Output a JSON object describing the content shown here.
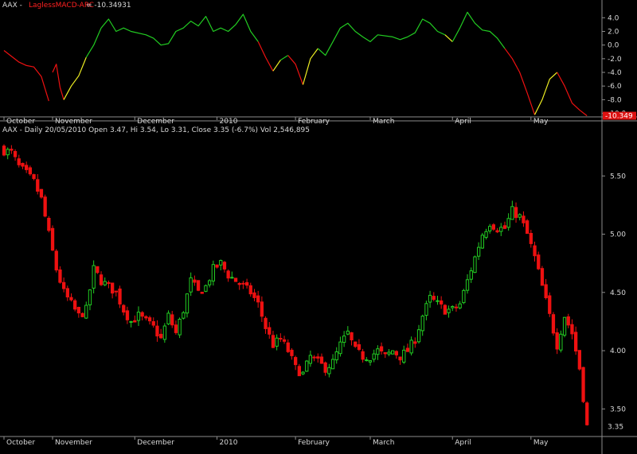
{
  "colors": {
    "background": "#000000",
    "text": "#d8d8d8",
    "axis_line": "#8c8c8c",
    "up": "#22cc22",
    "down": "#ee1111",
    "transition": "#eeee22",
    "indicator_name": "#ff2020"
  },
  "chart_data": [
    {
      "type": "line",
      "header": {
        "symbol": "AAX - ",
        "indicator": "LaglessMACD-ARC",
        "value_text": " = -10.34931"
      },
      "y_axis_ticks": [
        4.0,
        2.0,
        0.0,
        -2.0,
        -4.0,
        -6.0,
        -8.0,
        -10.0
      ],
      "y_tick_labels": [
        "4.0",
        "2.0",
        "0.0",
        "-2.0",
        "-4.0",
        "-6.0",
        "-8.0",
        "-10.0"
      ],
      "ylim": [
        -10.4,
        5.2
      ],
      "last_value_label": "-10.349",
      "x_index_range": [
        0,
        160
      ],
      "x_tick_labels": [
        "October",
        "November",
        "December",
        "2010",
        "February",
        "March",
        "April",
        "May"
      ],
      "x_tick_index": [
        0,
        13,
        35,
        57,
        78,
        98,
        120,
        141
      ],
      "series": [
        {
          "color_role": "down",
          "points": [
            [
              0,
              -0.8
            ],
            [
              4,
              -2.5
            ],
            [
              6,
              -3.0
            ],
            [
              8,
              -3.2
            ],
            [
              10,
              -4.6
            ],
            [
              12,
              -8.2
            ]
          ]
        },
        {
          "color_role": "down",
          "points": [
            [
              13,
              -4.0
            ],
            [
              14,
              -2.8
            ],
            [
              15,
              -6.2
            ],
            [
              16,
              -8.0
            ]
          ]
        },
        {
          "color_role": "transition",
          "points": [
            [
              16,
              -8.0
            ],
            [
              18,
              -6.0
            ],
            [
              20,
              -4.5
            ],
            [
              22,
              -1.8
            ]
          ]
        },
        {
          "color_role": "up",
          "points": [
            [
              22,
              -1.8
            ],
            [
              24,
              0.0
            ],
            [
              26,
              2.5
            ],
            [
              28,
              3.8
            ],
            [
              30,
              2.0
            ],
            [
              32,
              2.5
            ],
            [
              34,
              2.0
            ],
            [
              38,
              1.5
            ],
            [
              40,
              1.0
            ],
            [
              42,
              0.0
            ],
            [
              44,
              0.2
            ],
            [
              46,
              2.0
            ],
            [
              48,
              2.5
            ],
            [
              50,
              3.5
            ],
            [
              52,
              2.8
            ],
            [
              54,
              4.2
            ],
            [
              56,
              2.0
            ],
            [
              58,
              2.5
            ],
            [
              60,
              2.0
            ],
            [
              62,
              3.0
            ],
            [
              64,
              4.5
            ],
            [
              66,
              2.0
            ],
            [
              68,
              0.5
            ]
          ]
        },
        {
          "color_role": "down",
          "points": [
            [
              68,
              0.5
            ],
            [
              70,
              -1.8
            ],
            [
              72,
              -3.8
            ]
          ]
        },
        {
          "color_role": "transition",
          "points": [
            [
              72,
              -3.8
            ],
            [
              74,
              -2.2
            ]
          ]
        },
        {
          "color_role": "up",
          "points": [
            [
              74,
              -2.2
            ],
            [
              76,
              -1.5
            ]
          ]
        },
        {
          "color_role": "down",
          "points": [
            [
              76,
              -1.5
            ],
            [
              78,
              -2.8
            ],
            [
              80,
              -5.8
            ]
          ]
        },
        {
          "color_role": "transition",
          "points": [
            [
              80,
              -5.8
            ],
            [
              82,
              -2.0
            ],
            [
              84,
              -0.5
            ]
          ]
        },
        {
          "color_role": "up",
          "points": [
            [
              84,
              -0.5
            ],
            [
              86,
              -1.5
            ],
            [
              88,
              0.5
            ],
            [
              90,
              2.5
            ],
            [
              92,
              3.2
            ],
            [
              94,
              2.0
            ],
            [
              96,
              1.2
            ],
            [
              98,
              0.5
            ],
            [
              100,
              1.5
            ],
            [
              104,
              1.2
            ],
            [
              106,
              0.8
            ],
            [
              108,
              1.2
            ],
            [
              110,
              1.8
            ],
            [
              112,
              3.8
            ],
            [
              114,
              3.2
            ],
            [
              116,
              2.0
            ],
            [
              118,
              1.5
            ]
          ]
        },
        {
          "color_role": "transition",
          "points": [
            [
              118,
              1.5
            ],
            [
              120,
              0.5
            ]
          ]
        },
        {
          "color_role": "up",
          "points": [
            [
              120,
              0.5
            ],
            [
              122,
              2.5
            ],
            [
              124,
              4.8
            ],
            [
              126,
              3.2
            ],
            [
              128,
              2.2
            ],
            [
              130,
              2.0
            ],
            [
              132,
              1.0
            ],
            [
              134,
              -0.5
            ]
          ]
        },
        {
          "color_role": "down",
          "points": [
            [
              134,
              -0.5
            ],
            [
              136,
              -2.0
            ],
            [
              138,
              -4.0
            ],
            [
              140,
              -7.0
            ],
            [
              142,
              -10.2
            ]
          ]
        },
        {
          "color_role": "transition",
          "points": [
            [
              142,
              -10.2
            ],
            [
              144,
              -8.0
            ],
            [
              146,
              -5.0
            ],
            [
              148,
              -4.0
            ]
          ]
        },
        {
          "color_role": "down",
          "points": [
            [
              148,
              -4.0
            ],
            [
              150,
              -6.0
            ],
            [
              152,
              -8.5
            ],
            [
              154,
              -9.5
            ],
            [
              156,
              -10.35
            ]
          ]
        }
      ]
    },
    {
      "type": "candlestick",
      "header": {
        "symbol": "AAX",
        "period": "Daily",
        "date": "20/05/2010",
        "open": "3.47",
        "high": "3.54",
        "low": "3.31",
        "close": "3.35",
        "change_pct": "-6.7%",
        "volume": "2,546,895"
      },
      "header_text": "AAX - Daily 20/05/2010 Open 3.47, Hi 3.54, Lo 3.31, Close 3.35 (-6.7%) Vol 2,546,895",
      "y_axis_ticks": [
        5.5,
        5.0,
        4.5,
        4.0,
        3.5
      ],
      "y_tick_labels": [
        "5.50",
        "5.00",
        "4.50",
        "4.00",
        "3.50"
      ],
      "ylim": [
        3.27,
        5.85
      ],
      "last_price_label": "3.35",
      "x_index_range": [
        0,
        160
      ],
      "x_tick_labels": [
        "October",
        "November",
        "December",
        "2010",
        "February",
        "March",
        "April",
        "May"
      ],
      "x_tick_index": [
        0,
        13,
        35,
        57,
        78,
        98,
        120,
        141
      ],
      "close_path": [
        [
          0,
          5.72
        ],
        [
          2,
          5.7
        ],
        [
          4,
          5.58
        ],
        [
          6,
          5.52
        ],
        [
          8,
          5.45
        ],
        [
          10,
          5.3
        ],
        [
          12,
          5.0
        ],
        [
          14,
          4.7
        ],
        [
          16,
          4.5
        ],
        [
          18,
          4.4
        ],
        [
          20,
          4.3
        ],
        [
          22,
          4.35
        ],
        [
          24,
          4.7
        ],
        [
          26,
          4.6
        ],
        [
          28,
          4.55
        ],
        [
          30,
          4.5
        ],
        [
          32,
          4.35
        ],
        [
          34,
          4.25
        ],
        [
          36,
          4.3
        ],
        [
          38,
          4.25
        ],
        [
          40,
          4.2
        ],
        [
          42,
          4.1
        ],
        [
          44,
          4.3
        ],
        [
          46,
          4.15
        ],
        [
          48,
          4.35
        ],
        [
          50,
          4.6
        ],
        [
          52,
          4.5
        ],
        [
          54,
          4.55
        ],
        [
          56,
          4.7
        ],
        [
          58,
          4.75
        ],
        [
          60,
          4.65
        ],
        [
          62,
          4.6
        ],
        [
          64,
          4.55
        ],
        [
          66,
          4.5
        ],
        [
          68,
          4.4
        ],
        [
          70,
          4.2
        ],
        [
          72,
          4.05
        ],
        [
          74,
          4.1
        ],
        [
          76,
          4.0
        ],
        [
          78,
          3.85
        ],
        [
          80,
          3.8
        ],
        [
          82,
          3.95
        ],
        [
          84,
          3.9
        ],
        [
          86,
          3.85
        ],
        [
          88,
          3.9
        ],
        [
          90,
          4.05
        ],
        [
          92,
          4.15
        ],
        [
          94,
          4.0
        ],
        [
          96,
          3.95
        ],
        [
          98,
          3.95
        ],
        [
          100,
          4.0
        ],
        [
          102,
          3.95
        ],
        [
          104,
          4.0
        ],
        [
          106,
          3.95
        ],
        [
          108,
          4.0
        ],
        [
          110,
          4.1
        ],
        [
          112,
          4.3
        ],
        [
          114,
          4.45
        ],
        [
          116,
          4.4
        ],
        [
          118,
          4.35
        ],
        [
          120,
          4.35
        ],
        [
          122,
          4.4
        ],
        [
          124,
          4.6
        ],
        [
          126,
          4.8
        ],
        [
          128,
          5.0
        ],
        [
          130,
          5.1
        ],
        [
          132,
          5.05
        ],
        [
          134,
          5.05
        ],
        [
          136,
          5.2
        ],
        [
          138,
          5.15
        ],
        [
          140,
          5.0
        ],
        [
          142,
          4.8
        ],
        [
          144,
          4.55
        ],
        [
          146,
          4.3
        ],
        [
          148,
          4.05
        ],
        [
          150,
          4.3
        ],
        [
          152,
          4.15
        ],
        [
          154,
          3.85
        ],
        [
          156,
          3.35
        ]
      ]
    }
  ]
}
